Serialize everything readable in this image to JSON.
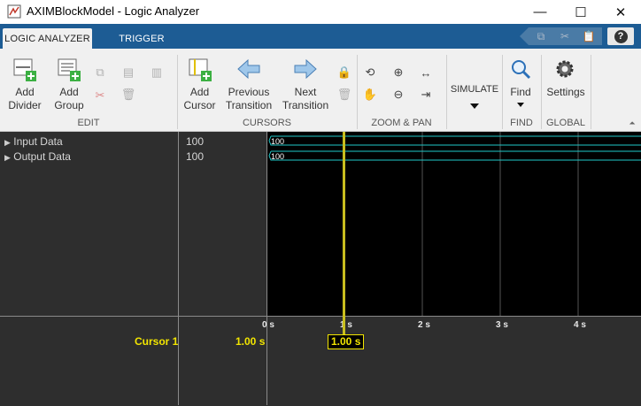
{
  "window": {
    "title": "AXIMBlockModel - Logic Analyzer",
    "minimize": "—",
    "maximize": "☐",
    "close": "✕"
  },
  "tabs": [
    {
      "label": "LOGIC ANALYZER",
      "active": true
    },
    {
      "label": "TRIGGER",
      "active": false
    }
  ],
  "help": "?",
  "toolstrip": {
    "edit": {
      "section": "EDIT",
      "add_divider": [
        "Add",
        "Divider"
      ],
      "add_group": [
        "Add",
        "Group"
      ]
    },
    "cursors": {
      "section": "CURSORS",
      "add_cursor": [
        "Add",
        "Cursor"
      ],
      "previous_transition": [
        "Previous",
        "Transition"
      ],
      "next_transition": [
        "Next",
        "Transition"
      ]
    },
    "zoom_pan": {
      "section": "ZOOM & PAN"
    },
    "simulate": {
      "label": "SIMULATE"
    },
    "find": {
      "section": "FIND",
      "label": "Find"
    },
    "global": {
      "section": "GLOBAL",
      "label": "Settings"
    }
  },
  "signals": [
    {
      "name": "Input Data",
      "value": "100",
      "wave_label": "100"
    },
    {
      "name": "Output Data",
      "value": "100",
      "wave_label": "100"
    }
  ],
  "time_axis": {
    "ticks": [
      "0 s",
      "1 s",
      "2 s",
      "3 s",
      "4 s"
    ]
  },
  "cursor": {
    "name": "Cursor 1",
    "value": "1.00 s",
    "tag": "1.00 s"
  },
  "colors": {
    "accent": "#1d5c94",
    "cursor": "#f2e500",
    "wave": "#20c8c8"
  }
}
